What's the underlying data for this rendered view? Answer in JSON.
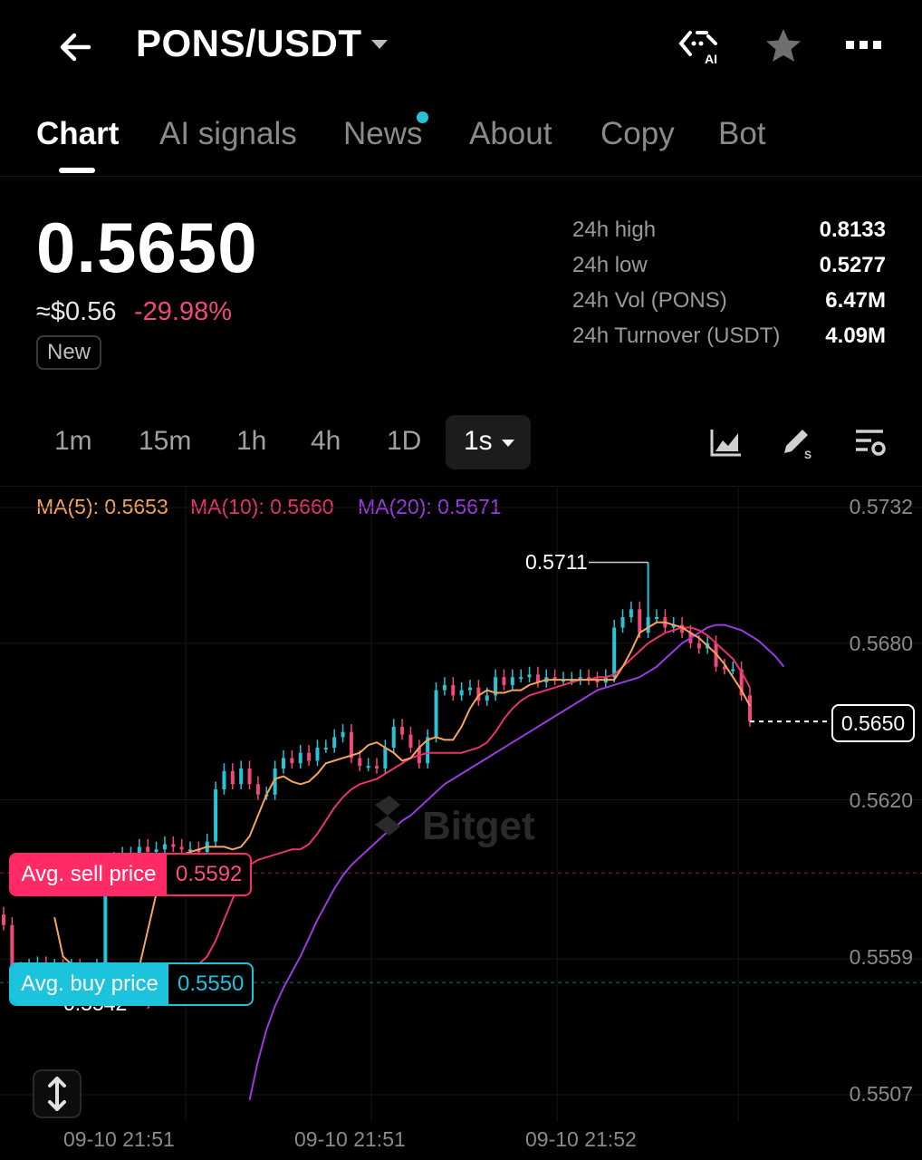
{
  "header": {
    "pair": "PONS/USDT",
    "icons": [
      "back-arrow-icon",
      "ai-icon",
      "star-icon",
      "more-icon"
    ],
    "ai_label": "AI"
  },
  "tabs": [
    {
      "label": "Chart",
      "active": true
    },
    {
      "label": "AI signals"
    },
    {
      "label": "News",
      "dot": true
    },
    {
      "label": "About"
    },
    {
      "label": "Copy"
    },
    {
      "label": "Bot"
    }
  ],
  "ticker": {
    "price": "0.5650",
    "usd_price": "≈$0.56",
    "change": "-29.98%",
    "badge": "New"
  },
  "stats": [
    {
      "label": "24h high",
      "value": "0.8133"
    },
    {
      "label": "24h low",
      "value": "0.5277"
    },
    {
      "label": "24h Vol (PONS)",
      "value": "6.47M"
    },
    {
      "label": "24h Turnover (USDT)",
      "value": "4.09M"
    }
  ],
  "intervals": [
    "1m",
    "15m",
    "1h",
    "4h",
    "1D"
  ],
  "selected_interval": "1s",
  "indicators": {
    "ma5": "MA(5): 0.5653",
    "ma10": "MA(10): 0.5660",
    "ma20": "MA(20): 0.5671"
  },
  "colors": {
    "up": "#29c3d8",
    "down": "#f0487a",
    "ma5": "#f6a35c",
    "ma10": "#e8336e",
    "ma20": "#9b3ae0"
  },
  "chart_data": {
    "type": "candlestick",
    "y_ticks": [
      "0.5732",
      "0.5680",
      "0.5620",
      "0.5559",
      "0.5507"
    ],
    "ylim": [
      0.5507,
      0.5732
    ],
    "x_ticks": [
      "09-10 21:51",
      "09-10 21:51",
      "09-10 21:52"
    ],
    "current_price": "0.5650",
    "high_marker": "0.5711",
    "low_marker": "0.5542",
    "avg_sell": {
      "label": "Avg. sell price",
      "value": "0.5592"
    },
    "avg_buy": {
      "label": "Avg. buy price",
      "value": "0.5550"
    },
    "close": [
      0.5572,
      0.5555,
      0.5554,
      0.5556,
      0.5557,
      0.5556,
      0.5556,
      0.5555,
      0.5556,
      0.5554,
      0.5553,
      0.5556,
      0.559,
      0.5597,
      0.5599,
      0.5599,
      0.5602,
      0.56,
      0.5601,
      0.5603,
      0.5602,
      0.5601,
      0.5601,
      0.56,
      0.5604,
      0.5624,
      0.5631,
      0.5626,
      0.5632,
      0.5626,
      0.5622,
      0.5622,
      0.5632,
      0.5636,
      0.5634,
      0.5638,
      0.5635,
      0.564,
      0.564,
      0.5644,
      0.5646,
      0.5636,
      0.5633,
      0.5633,
      0.5632,
      0.564,
      0.5648,
      0.5645,
      0.564,
      0.5634,
      0.5644,
      0.5662,
      0.5664,
      0.566,
      0.5662,
      0.5663,
      0.5658,
      0.566,
      0.5667,
      0.5664,
      0.5667,
      0.5667,
      0.5668,
      0.5665,
      0.5667,
      0.5666,
      0.5666,
      0.5666,
      0.5667,
      0.5666,
      0.5665,
      0.5667,
      0.5686,
      0.569,
      0.5693,
      0.5684,
      0.569,
      0.569,
      0.5686,
      0.5687,
      0.5684,
      0.568,
      0.5678,
      0.568,
      0.5671,
      0.567,
      0.567,
      0.566,
      0.565
    ],
    "ma5": [
      0.5575,
      0.556,
      0.5557,
      0.5556,
      0.5556,
      0.5556,
      0.5556,
      0.5556,
      0.5555,
      0.5555,
      0.5556,
      0.557,
      0.5584,
      0.5594,
      0.5598,
      0.5599,
      0.56,
      0.5601,
      0.5602,
      0.5602,
      0.5602,
      0.5601,
      0.5602,
      0.5606,
      0.5614,
      0.5622,
      0.5628,
      0.5629,
      0.5627,
      0.5626,
      0.5627,
      0.563,
      0.5634,
      0.5635,
      0.5636,
      0.5637,
      0.5638,
      0.5641,
      0.5642,
      0.564,
      0.5638,
      0.5635,
      0.5636,
      0.564,
      0.5643,
      0.5644,
      0.5643,
      0.5643,
      0.5648,
      0.5655,
      0.566,
      0.5662,
      0.5661,
      0.5661,
      0.5662,
      0.5662,
      0.5664,
      0.5665,
      0.5666,
      0.5666,
      0.5666,
      0.5666,
      0.5666,
      0.5666,
      0.5666,
      0.5666,
      0.5666,
      0.5671,
      0.5677,
      0.5684,
      0.5686,
      0.5688,
      0.5688,
      0.5687,
      0.5686,
      0.5684,
      0.5682,
      0.5679,
      0.5676,
      0.5672,
      0.5667,
      0.5662,
      0.5656
    ],
    "ma10": [
      0.554,
      0.5548,
      0.5553,
      0.5555,
      0.5556,
      0.5556,
      0.5557,
      0.556,
      0.5566,
      0.5574,
      0.5582,
      0.559,
      0.5595,
      0.5597,
      0.5598,
      0.5599,
      0.56,
      0.5601,
      0.5601,
      0.5603,
      0.5607,
      0.5612,
      0.5617,
      0.5621,
      0.5624,
      0.5626,
      0.5627,
      0.5628,
      0.563,
      0.5632,
      0.5634,
      0.5636,
      0.5637,
      0.5638,
      0.5638,
      0.5638,
      0.5638,
      0.5638,
      0.5639,
      0.564,
      0.5642,
      0.5646,
      0.5651,
      0.5655,
      0.5658,
      0.566,
      0.5661,
      0.5662,
      0.5663,
      0.5664,
      0.5665,
      0.5666,
      0.5666,
      0.5667,
      0.5667,
      0.5668,
      0.5671,
      0.5674,
      0.5677,
      0.568,
      0.5682,
      0.5684,
      0.5685,
      0.5686,
      0.5686,
      0.5685,
      0.5683,
      0.568,
      0.5677,
      0.5674,
      0.5669,
      0.5663
    ],
    "ma20": [
      0.5505,
      0.552,
      0.5532,
      0.5541,
      0.5548,
      0.5554,
      0.556,
      0.5567,
      0.5574,
      0.558,
      0.5586,
      0.5591,
      0.5595,
      0.5598,
      0.5601,
      0.5604,
      0.5607,
      0.5609,
      0.5612,
      0.5614,
      0.5617,
      0.562,
      0.5623,
      0.5626,
      0.5628,
      0.563,
      0.5632,
      0.5634,
      0.5636,
      0.5638,
      0.564,
      0.5642,
      0.5644,
      0.5646,
      0.5648,
      0.565,
      0.5652,
      0.5654,
      0.5656,
      0.5658,
      0.566,
      0.5662,
      0.5663,
      0.5664,
      0.5665,
      0.5666,
      0.5667,
      0.5669,
      0.5671,
      0.5674,
      0.5677,
      0.568,
      0.5682,
      0.5684,
      0.5686,
      0.5687,
      0.5687,
      0.5686,
      0.5685,
      0.5683,
      0.5681,
      0.5678,
      0.5675,
      0.5671
    ]
  },
  "watermark": "Bitget"
}
